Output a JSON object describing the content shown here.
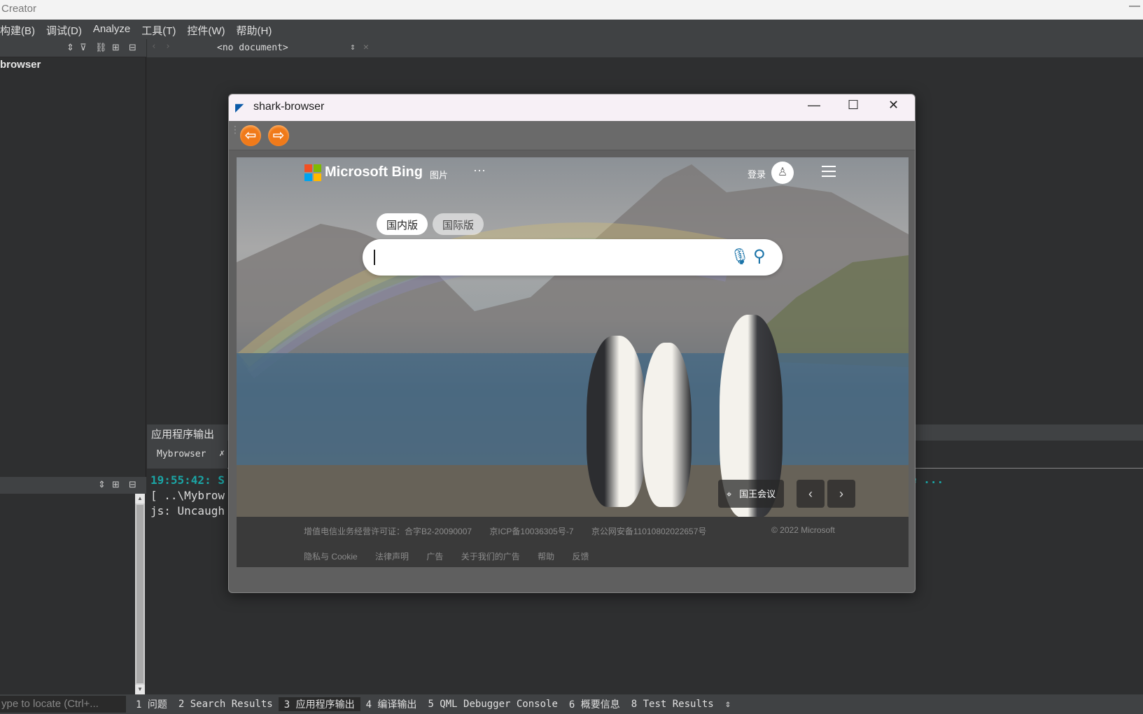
{
  "app": {
    "title": "Creator",
    "minimize": "—"
  },
  "menu": [
    "构建(B)",
    "调试(D)",
    "Analyze",
    "工具(T)",
    "控件(W)",
    "帮助(H)"
  ],
  "editor": {
    "document_selector": "<no document>"
  },
  "project_tree": {
    "root": "browser"
  },
  "output": {
    "header": "应用程序输出",
    "tab": "Mybrowser",
    "lines": [
      {
        "time": "19:55:42: S",
        "text": ""
      },
      {
        "time": "",
        "text": "[ ..\\Mybrow"
      },
      {
        "time": "",
        "text": "js: Uncaugh"
      }
    ],
    "tail": "e ..."
  },
  "statusbar": {
    "locate_placeholder": "ype to locate (Ctrl+...",
    "tabs": [
      "1 问题",
      "2 Search Results",
      "3 应用程序输出",
      "4 编译输出",
      "5 QML Debugger Console",
      "6 概要信息",
      "8 Test Results"
    ],
    "active_tab_index": 2
  },
  "browser": {
    "title": "shark-browser",
    "back_icon": "back-arrow-icon",
    "forward_icon": "forward-arrow-icon"
  },
  "bing": {
    "brand": "Microsoft Bing",
    "nav_images": "图片",
    "nav_more": "···",
    "login": "登录",
    "toggle_domestic": "国内版",
    "toggle_international": "国际版",
    "search_value": "",
    "image_location": "国王会议",
    "footer_line1": [
      "增值电信业务经营许可证：合字B2-20090007",
      "京ICP备10036305号-7",
      "京公网安备11010802022657号"
    ],
    "copyright": "© 2022 Microsoft",
    "footer_links": [
      "隐私与 Cookie",
      "法律声明",
      "广告",
      "关于我们的广告",
      "帮助",
      "反馈"
    ],
    "colors": {
      "mic": "#1a73a8",
      "nav_button": "#f07a1a"
    }
  }
}
